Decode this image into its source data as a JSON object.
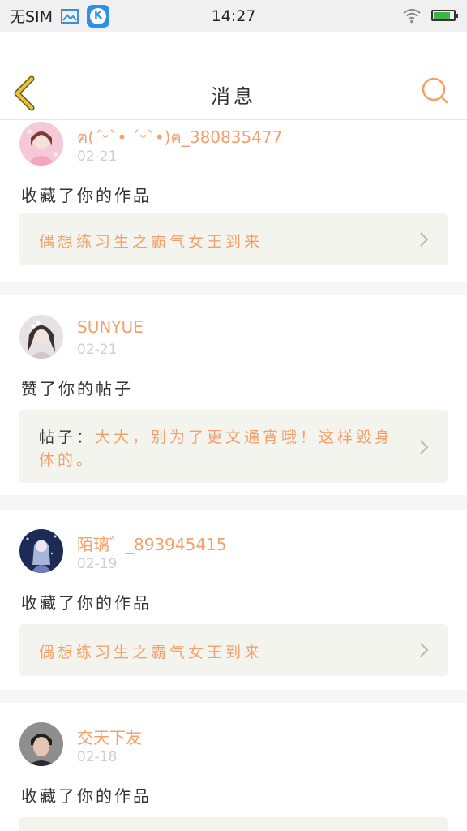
{
  "status_bar": {
    "sim_text": "无SIM",
    "time": "14:27"
  },
  "header": {
    "title": "消息"
  },
  "notifications": [
    {
      "username": "ฅ(ˊᵕˋ• ˊᵕˋ•)ฅ_380835477",
      "date": "02-21",
      "action": "收藏了你的作品",
      "ref_prefix": "",
      "ref_text": "偶想练习生之霸气女王到来"
    },
    {
      "username": "SUNYUE",
      "date": "02-21",
      "action": "赞了你的帖子",
      "ref_prefix": "帖子：",
      "ref_text": "大大，别为了更文通宵哦！这样毁身体的。"
    },
    {
      "username": "陌璃゛_893945415",
      "date": "02-19",
      "action": "收藏了你的作品",
      "ref_prefix": "",
      "ref_text": "偶想练习生之霸气女王到来"
    },
    {
      "username": "交天下友",
      "date": "02-18",
      "action": "收藏了你的作品",
      "ref_prefix": "",
      "ref_text": ""
    }
  ],
  "colors": {
    "accent": "#f5a06a",
    "back_arrow": "#e8c23a",
    "date": "#cfcfcf",
    "ref_bg": "#f4f4ee"
  }
}
